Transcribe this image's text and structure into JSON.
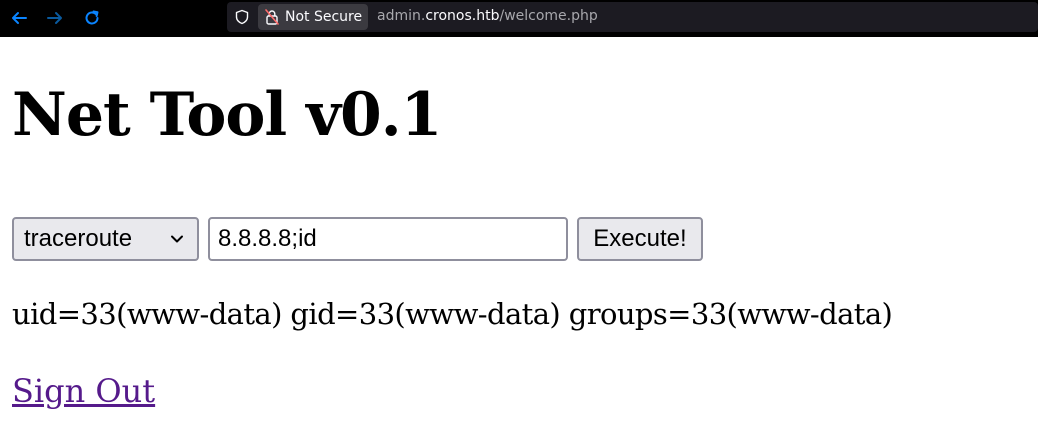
{
  "browser": {
    "security_label": "Not Secure",
    "url": {
      "subdomain": "admin.",
      "domain": "cronos.htb",
      "path": "/welcome.php"
    },
    "icons": {
      "back": "arrow-left-icon",
      "forward": "arrow-right-icon",
      "reload": "reload-icon",
      "tracking": "shield-icon",
      "insecure": "lock-slash-icon"
    },
    "colors": {
      "nav_icon": "#0a84ff",
      "forward_icon_disabled": "#0a5a9e"
    }
  },
  "page": {
    "title": "Net Tool v0.1",
    "form": {
      "selected_command": "traceroute",
      "host_value": "8.8.8.8;id",
      "submit_label": "Execute!"
    },
    "output": "uid=33(www-data) gid=33(www-data) groups=33(www-data)",
    "signout_label": "Sign Out"
  }
}
